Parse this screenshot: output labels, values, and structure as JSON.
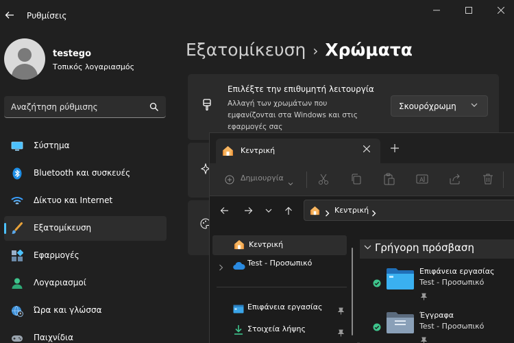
{
  "window": {
    "title": "Ρυθμίσεις",
    "controls": {
      "minimize": "—",
      "maximize": "☐",
      "close": "✕"
    }
  },
  "account": {
    "name": "testego",
    "type": "Τοπικός λογαριασμός"
  },
  "search": {
    "placeholder": "Αναζήτηση ρύθμισης"
  },
  "sidebar": {
    "items": [
      {
        "label": "Σύστημα",
        "icon": "system-icon"
      },
      {
        "label": "Bluetooth και συσκευές",
        "icon": "bluetooth-icon"
      },
      {
        "label": "Δίκτυο και Internet",
        "icon": "wifi-icon"
      },
      {
        "label": "Εξατομίκευση",
        "icon": "brush-icon",
        "active": true
      },
      {
        "label": "Εφαρμογές",
        "icon": "apps-icon"
      },
      {
        "label": "Λογαριασμοί",
        "icon": "account-icon"
      },
      {
        "label": "Ώρα και γλώσσα",
        "icon": "globe-clock-icon"
      },
      {
        "label": "Παιχνίδια",
        "icon": "gamepad-icon"
      }
    ]
  },
  "breadcrumb": {
    "parent": "Εξατομίκευση",
    "separator": "›",
    "current": "Χρώματα"
  },
  "mode_card": {
    "title": "Επιλέξτε την επιθυμητή λειτουργία",
    "description": "Αλλαγή των χρωμάτων που εμφανίζονται στα Windows και στις εφαρμογές σας",
    "selected": "Σκουρόχρωμη"
  },
  "explorer": {
    "tab_label": "Κεντρική",
    "toolbar": {
      "create_label": "Δημιουργία"
    },
    "address": {
      "location": "Κεντρική"
    },
    "navpane": {
      "home": "Κεντρική",
      "onedrive": "Test - Προσωπικό",
      "desktop": "Επιφάνεια εργασίας",
      "downloads": "Στοιχεία λήψης"
    },
    "quick_access": {
      "title": "Γρήγορη πρόσβαση",
      "items": [
        {
          "name": "Επιφάνεια εργασίας",
          "location": "Test - Προσωπικό"
        },
        {
          "name": "Έγγραφα",
          "location": "Test - Προσωπικό"
        }
      ]
    }
  },
  "colors": {
    "accent": "#4cc2ff",
    "background": "#202020",
    "card": "#2b2b2b"
  }
}
